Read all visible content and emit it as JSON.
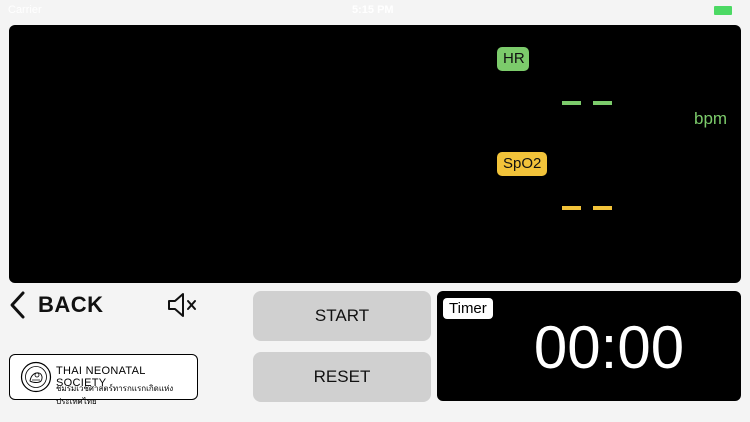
{
  "status_bar": {
    "carrier": "Carrier",
    "time": "5:15 PM"
  },
  "monitor": {
    "hr": {
      "label": "HR",
      "value_placeholder": "– –",
      "unit": "bpm",
      "color": "#7ccb6b"
    },
    "spo2": {
      "label": "SpO2",
      "value_placeholder": "– –",
      "color": "#f2c33a"
    }
  },
  "nav": {
    "back_label": "BACK"
  },
  "logo": {
    "title": "THAI NEONATAL SOCIETY",
    "subtitle": "ชมรมเวชศาสตร์ทารกแรกเกิดแห่งประเทศไทย"
  },
  "controls": {
    "start_label": "START",
    "reset_label": "RESET"
  },
  "timer": {
    "label": "Timer",
    "value": "00:00"
  },
  "icons": {
    "back": "chevron-left-icon",
    "mute": "speaker-muted-icon"
  }
}
